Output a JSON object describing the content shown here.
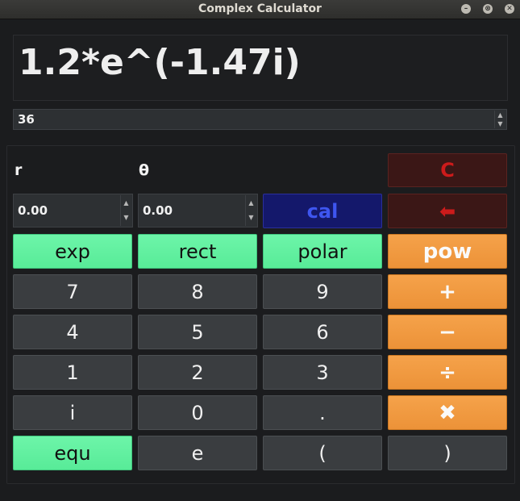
{
  "window": {
    "title": "Complex Calculator",
    "controls": [
      "minimize",
      "maximize",
      "close"
    ]
  },
  "display": {
    "expression": "1.2*e^(-1.47i)"
  },
  "precision_spinbox": {
    "value": "36"
  },
  "labels": {
    "r": "r",
    "theta": "θ"
  },
  "r_spinbox": {
    "value": "0.00"
  },
  "theta_spinbox": {
    "value": "0.00"
  },
  "buttons": {
    "clear": "C",
    "backspace": "⬅",
    "cal": "cal",
    "exp": "exp",
    "rect": "rect",
    "polar": "polar",
    "pow": "pow",
    "seven": "7",
    "eight": "8",
    "nine": "9",
    "plus": "+",
    "four": "4",
    "five": "5",
    "six": "6",
    "minus": "−",
    "one": "1",
    "two": "2",
    "three": "3",
    "divide": "÷",
    "i": "i",
    "zero": "0",
    "dot": ".",
    "multiply": "✖",
    "equ": "equ",
    "e": "e",
    "lparen": "(",
    "rparen": ")"
  },
  "colors": {
    "background": "#1b1c1e",
    "green_button": "#5ff09e",
    "orange_button": "#f09a40",
    "gray_button": "#3a3d40",
    "clear_text": "#cc1b1b",
    "cal_text": "#3e56f0"
  }
}
